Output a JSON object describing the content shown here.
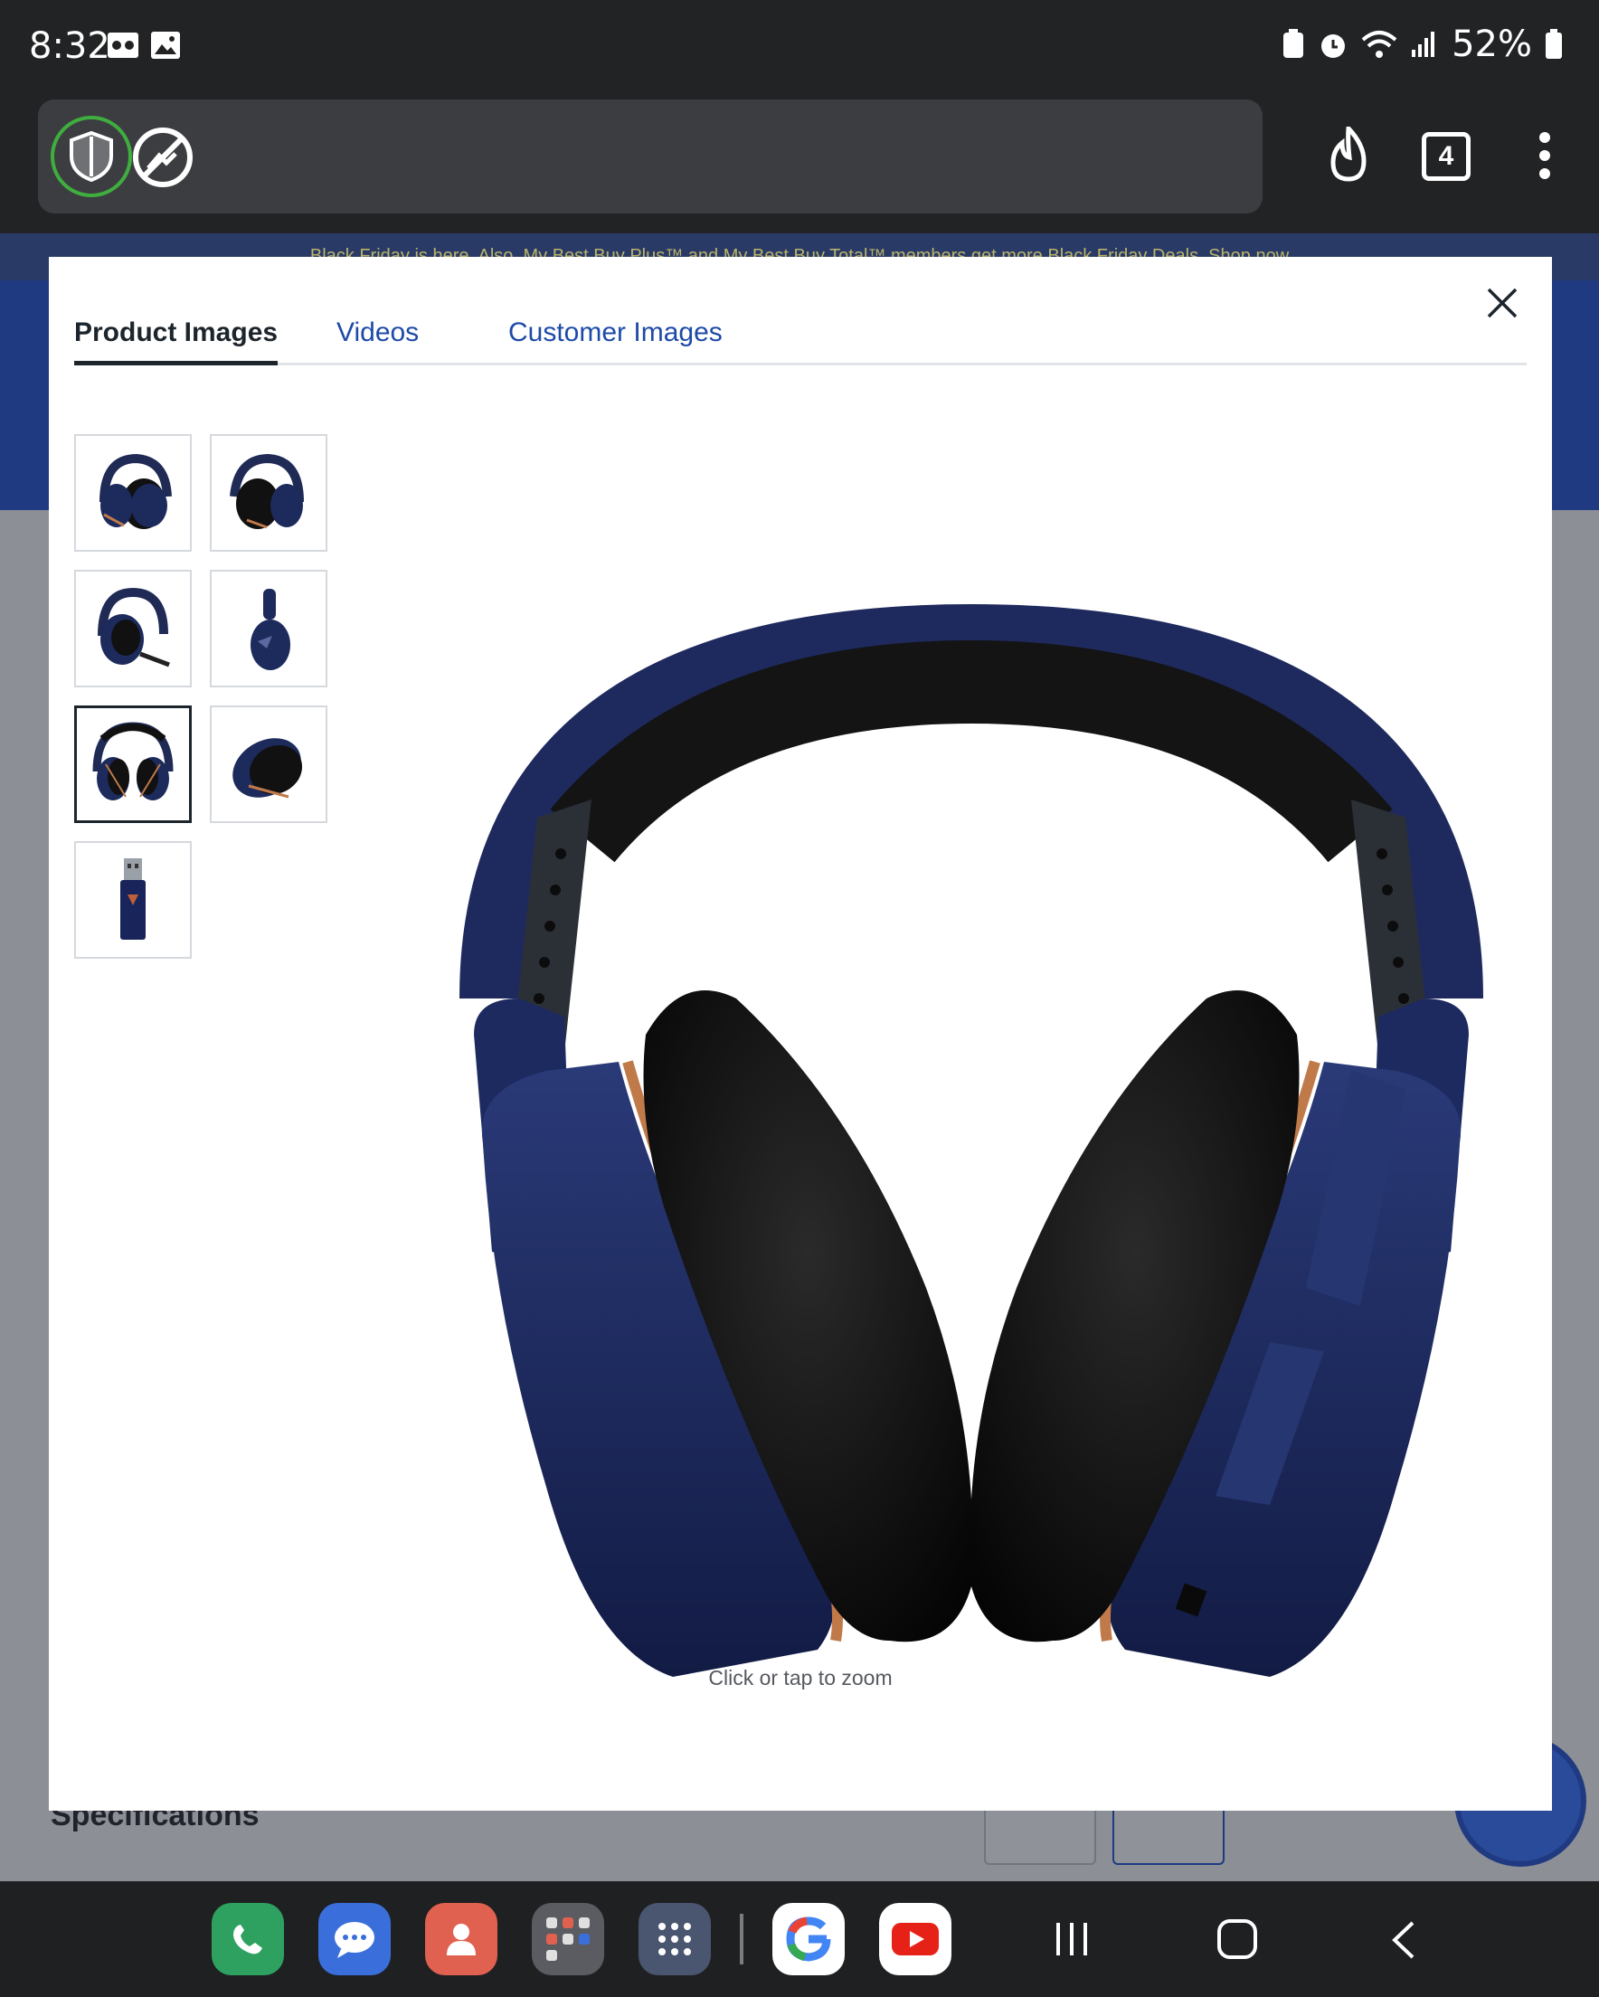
{
  "status_bar": {
    "time": "8:32",
    "battery": "52%"
  },
  "browser": {
    "tab_count": "4"
  },
  "background_page": {
    "promo_text": "Black Friday is here. Also, My Best Buy Plus™ and My Best Buy Total™ members get more Black Friday Deals. Shop now",
    "specifications_heading": "Specifications"
  },
  "modal": {
    "tabs": [
      {
        "label": "Product Images",
        "active": true
      },
      {
        "label": "Videos",
        "active": false
      },
      {
        "label": "Customer Images",
        "active": false
      }
    ],
    "thumbnails": [
      {
        "name": "headset-angle-left"
      },
      {
        "name": "headset-angle-right"
      },
      {
        "name": "headset-mic-down"
      },
      {
        "name": "headset-side"
      },
      {
        "name": "headset-front",
        "selected": true
      },
      {
        "name": "earcup-closeup"
      },
      {
        "name": "usb-transmitter"
      }
    ],
    "zoom_hint": "Click or tap to zoom"
  },
  "colors": {
    "navy": "#1d2a5c",
    "copper": "#c07a4a",
    "link_blue": "#1d4aa8"
  }
}
